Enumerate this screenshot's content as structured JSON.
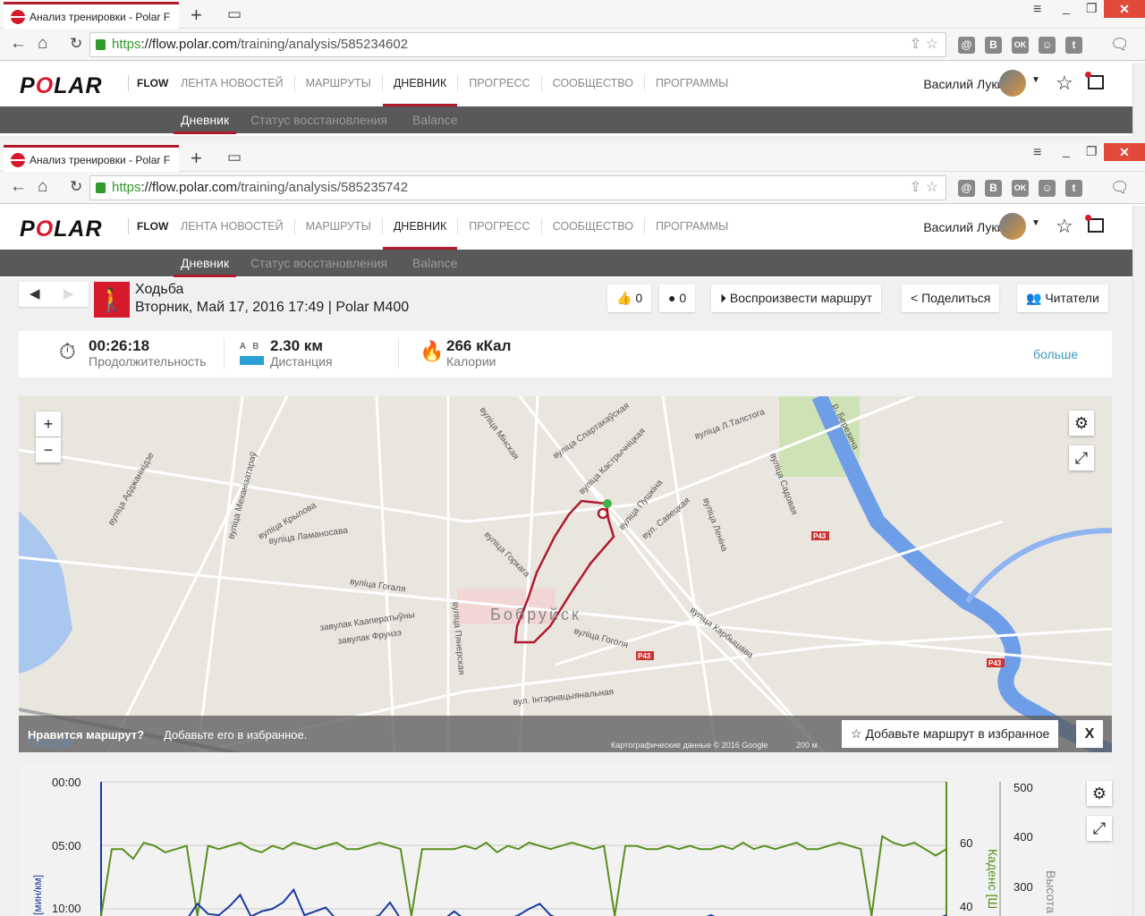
{
  "windows": [
    {
      "tab_title": "Анализ тренировки - Polar F",
      "url_scheme": "https",
      "url_domain": "://flow.polar.com",
      "url_path": "/training/analysis/585234602"
    },
    {
      "tab_title": "Анализ тренировки - Polar F",
      "url_scheme": "https",
      "url_domain": "://flow.polar.com",
      "url_path": "/training/analysis/585235742"
    }
  ],
  "site": {
    "logo": "POLAR",
    "flow": "FLOW",
    "menu": [
      "ЛЕНТА НОВОСТЕЙ",
      "МАРШРУТЫ",
      "ДНЕВНИК",
      "ПРОГРЕСС",
      "СООБЩЕСТВО",
      "ПРОГРАММЫ"
    ],
    "user_name": "Василий Лукин",
    "subnav": [
      "Дневник",
      "Статус восстановления",
      "Balance"
    ]
  },
  "ext_icons": [
    "@",
    "B",
    "OK",
    "☺",
    "t"
  ],
  "activity": {
    "sport": "Ходьба",
    "date_device": "Вторник, Май 17, 2016 17:49 | Polar M400",
    "likes": "0",
    "comments": "0",
    "play_route": "Воспроизвести маршрут",
    "share": "Поделиться",
    "followers": "Читатели"
  },
  "summary": {
    "duration_value": "00:26:18",
    "duration_label": "Продолжительность",
    "distance_ab": "A   B",
    "distance_value": "2.30 км",
    "distance_label": "Дистанция",
    "calories_value": "266 кКал",
    "calories_label": "Калории",
    "more": "больше"
  },
  "map": {
    "city": "Бобруйск",
    "streets": [
      "вуліца Мінская",
      "вуліца Гогаля",
      "вуліца Крылова",
      "вуліца Ламаносава",
      "вуліца Пушкіна",
      "вуліца Леніна",
      "вуліца Карбышава",
      "вул. Інтэрнацыянальная",
      "вуліца Спартакаўская",
      "вуліца Кастрычніцкая",
      "вуліца Л.Талстога",
      "вуліца Садовая",
      "вуліца Гоголя",
      "р. Березина",
      "вуліца Арджанікідзе",
      "вуліца Механізатараў",
      "вуліца Горкага",
      "вул. Савецкая",
      "вуліца Пянерская",
      "завулак Кааператыўны",
      "завулак Фрунзэ"
    ],
    "road_badges": [
      "P43",
      "P43",
      "P43"
    ],
    "promo_bold": "Нравится маршрут?",
    "promo_text": "Добавьте его в избранное.",
    "add_favorite": "Добавьте маршрут в избранное",
    "close": "X",
    "attribution": "Картографические данные © 2016 Google",
    "scale": "200 м",
    "google": "Google"
  },
  "chart_data": {
    "type": "line",
    "y_left_label": "[мин/км]",
    "y_left_ticks": [
      "00:00",
      "05:00",
      "10:00"
    ],
    "y_right1_label": "Каденс [Ш",
    "y_right1_ticks": [
      "60",
      "40"
    ],
    "y_right2_label": "Высота",
    "y_right2_ticks": [
      "500",
      "400",
      "300"
    ],
    "series": [
      {
        "name": "Каденс",
        "color": "#5a8f1e",
        "values": [
          0,
          58,
          58,
          55,
          60,
          59,
          57,
          58,
          59,
          0,
          59,
          58,
          59,
          60,
          58,
          57,
          59,
          58,
          60,
          59,
          58,
          59,
          60,
          58,
          58,
          59,
          60,
          59,
          58,
          0,
          58,
          58,
          58,
          58,
          59,
          58,
          60,
          57,
          59,
          58,
          60,
          59,
          58,
          59,
          60,
          59,
          58,
          59,
          0,
          59,
          59,
          58,
          58,
          59,
          58,
          59,
          58,
          58,
          59,
          58,
          60,
          58,
          59,
          58,
          59,
          60,
          58,
          58,
          59,
          60,
          59,
          58,
          0,
          62,
          60,
          59,
          60,
          58,
          56,
          58
        ]
      },
      {
        "name": "Темп",
        "color": "#1a3aa0",
        "values_min_per_km": [
          12,
          12,
          12,
          12,
          12,
          12,
          12,
          12,
          12,
          9.6,
          10.4,
          10.5,
          9.8,
          8.9,
          10.6,
          10.2,
          10.0,
          9.5,
          8.5,
          10.5,
          10.2,
          9.9,
          10.9,
          11,
          11,
          11,
          10.5,
          9.5,
          10.8,
          12,
          12,
          11.5,
          11,
          10.2,
          10.9,
          12,
          12,
          11.6,
          11,
          10.5,
          10,
          9.6,
          10.5,
          11.2,
          12,
          12,
          12,
          12,
          12,
          12,
          12,
          12,
          12,
          12,
          12,
          11.6,
          10.8,
          10.5,
          11,
          12,
          12,
          12,
          11.2,
          10.8,
          10.9,
          11,
          10.9,
          10.9,
          11.5,
          12,
          12,
          12,
          11,
          12,
          12,
          11.6,
          11,
          11.4,
          10.8,
          10.5
        ]
      }
    ],
    "pace_range": [
      0,
      12
    ],
    "cadence_range_at_ticks": [
      60,
      40
    ]
  }
}
